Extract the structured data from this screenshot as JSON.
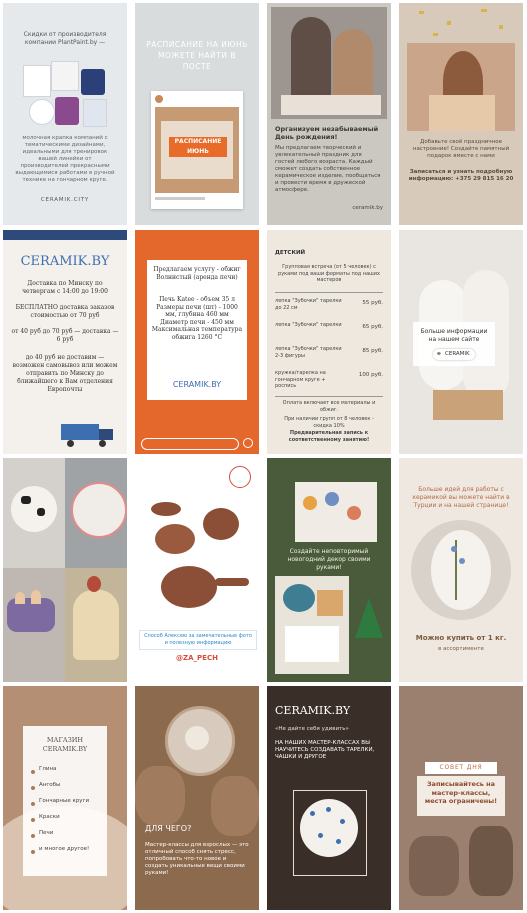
{
  "tiles": {
    "r1c1": {
      "title": "Скидки от производителя компании PlantPaint.by —",
      "body": "молочная крапка компаний с тематическими дизайнами, идеальными для тренировок вашей линейки от производителей прекрасными выдающимися работами в ручной технике на гончарном круге.",
      "footer": "CERAMIK.CITY"
    },
    "r1c2": {
      "headline": "РАСПИСАНИЕ НА ИЮНЬ МОЖЕТЕ НАЙТИ В ПОСТЕ",
      "sticker": "РАСПИСАНИЕ ИЮНЬ"
    },
    "r1c3": {
      "heading": "Организуем незабываемый День рождения!",
      "body": "Мы предлагаем творческий и увлекательный праздник для гостей любого возраста. Каждый сможет создать собственное керамическое изделие, пообщаться и провести время в дружеской атмосфере.",
      "handle": "ceramik.by"
    },
    "r1c4": {
      "body": "Добавьте своё праздничное настроение! Создайте памятный подарок вместе с нами",
      "cta": "Записаться и узнать подробную информацию: +375 29 815 16 20"
    },
    "r2c1": {
      "brand": "CERAMIK.BY",
      "line1": "Доставка по Минску по четвергам с 14:00 до 19:00",
      "line2": "БЕСПЛАТНО доставка заказов стоимостью от 70 руб",
      "line3": "от 40 руб до 70 руб — доставка — 6 руб",
      "line4": "до 40 руб не доставим — возможен самовывоз или можем отправить по Минску до ближайшего к Вам отделения Европочты"
    },
    "r2c2": {
      "title": "Предлагаем услугу - обжиг Волнистый (аренда печи)",
      "body": "Печь Katee - объем 35 л Размеры печи (шт) - 1000 мм, глубина 460 мм Диаметр печи - 450 мм Максимальная температура обжига 1260 °С",
      "brand": "CERAMIK.BY"
    },
    "r2c3": {
      "col1": "ДЕТСКИЙ",
      "intro": "Групповая встреча (от 5 человек) с руками под ваши форматы под наших мастеров",
      "rows": [
        {
          "item": "лепка \"Зубочки\" тарелки до 22 см",
          "price": "55 руб."
        },
        {
          "item": "лепка \"Зубочки\" тарелки",
          "price": "65 руб."
        },
        {
          "item": "лепка \"Зубочки\" тарелки 2-3 фигуры",
          "price": "85 руб."
        },
        {
          "item": "кружка/тарелка на гончарном круге + роспись",
          "price": "100 руб."
        }
      ],
      "note1": "Оплата включает все материалы и обжиг.",
      "note2": "При наличии групп от 8 человек - скидка 10%",
      "note3": "Предварительная запись к соответственному занятию!"
    },
    "r2c4": {
      "line1": "Больше информации",
      "line2": "на нашем сайте",
      "badge": "CERAMIK"
    },
    "r3c2": {
      "caption": "Способ Алексею за замечательные фото и полезную информацию",
      "handle": "@ZA_PECH"
    },
    "r3c3": {
      "body": "Создайте неповторимый новогодний декор своими руками!"
    },
    "r3c4": {
      "body": "Больше идей для работы с керамикой вы можете найти в Турции и на нашей странице!",
      "price": "Можно купить от 1 кг.",
      "note": "в ассортименте"
    },
    "r4c1": {
      "title": "МАГАЗИН CERAMIK.BY",
      "items": [
        "Глина",
        "Ангобы",
        "Гончарные круги",
        "Краски",
        "Печи",
        "и многое другое!"
      ]
    },
    "r4c2": {
      "heading": "ДЛЯ ЧЕГО?",
      "body": "Мастер-классы для взрослых — это отличный способ снять стресс, попробовать что-то новое и создать уникальные вещи своими руками!"
    },
    "r4c3": {
      "brand": "CERAMIK.BY",
      "sub": "«Не дайте себя удивить»",
      "body": "НА НАШИХ МАСТЕР-КЛАССАХ ВЫ НАУЧИТЕСЬ СОЗДАВАТЬ ТАРЕЛКИ, ЧАШКИ И ДРУГОЕ"
    },
    "r4c4": {
      "tag": "СОВЕТ ДНЯ",
      "body": "Записывайтесь на мастер-классы, места ограничены!"
    }
  }
}
